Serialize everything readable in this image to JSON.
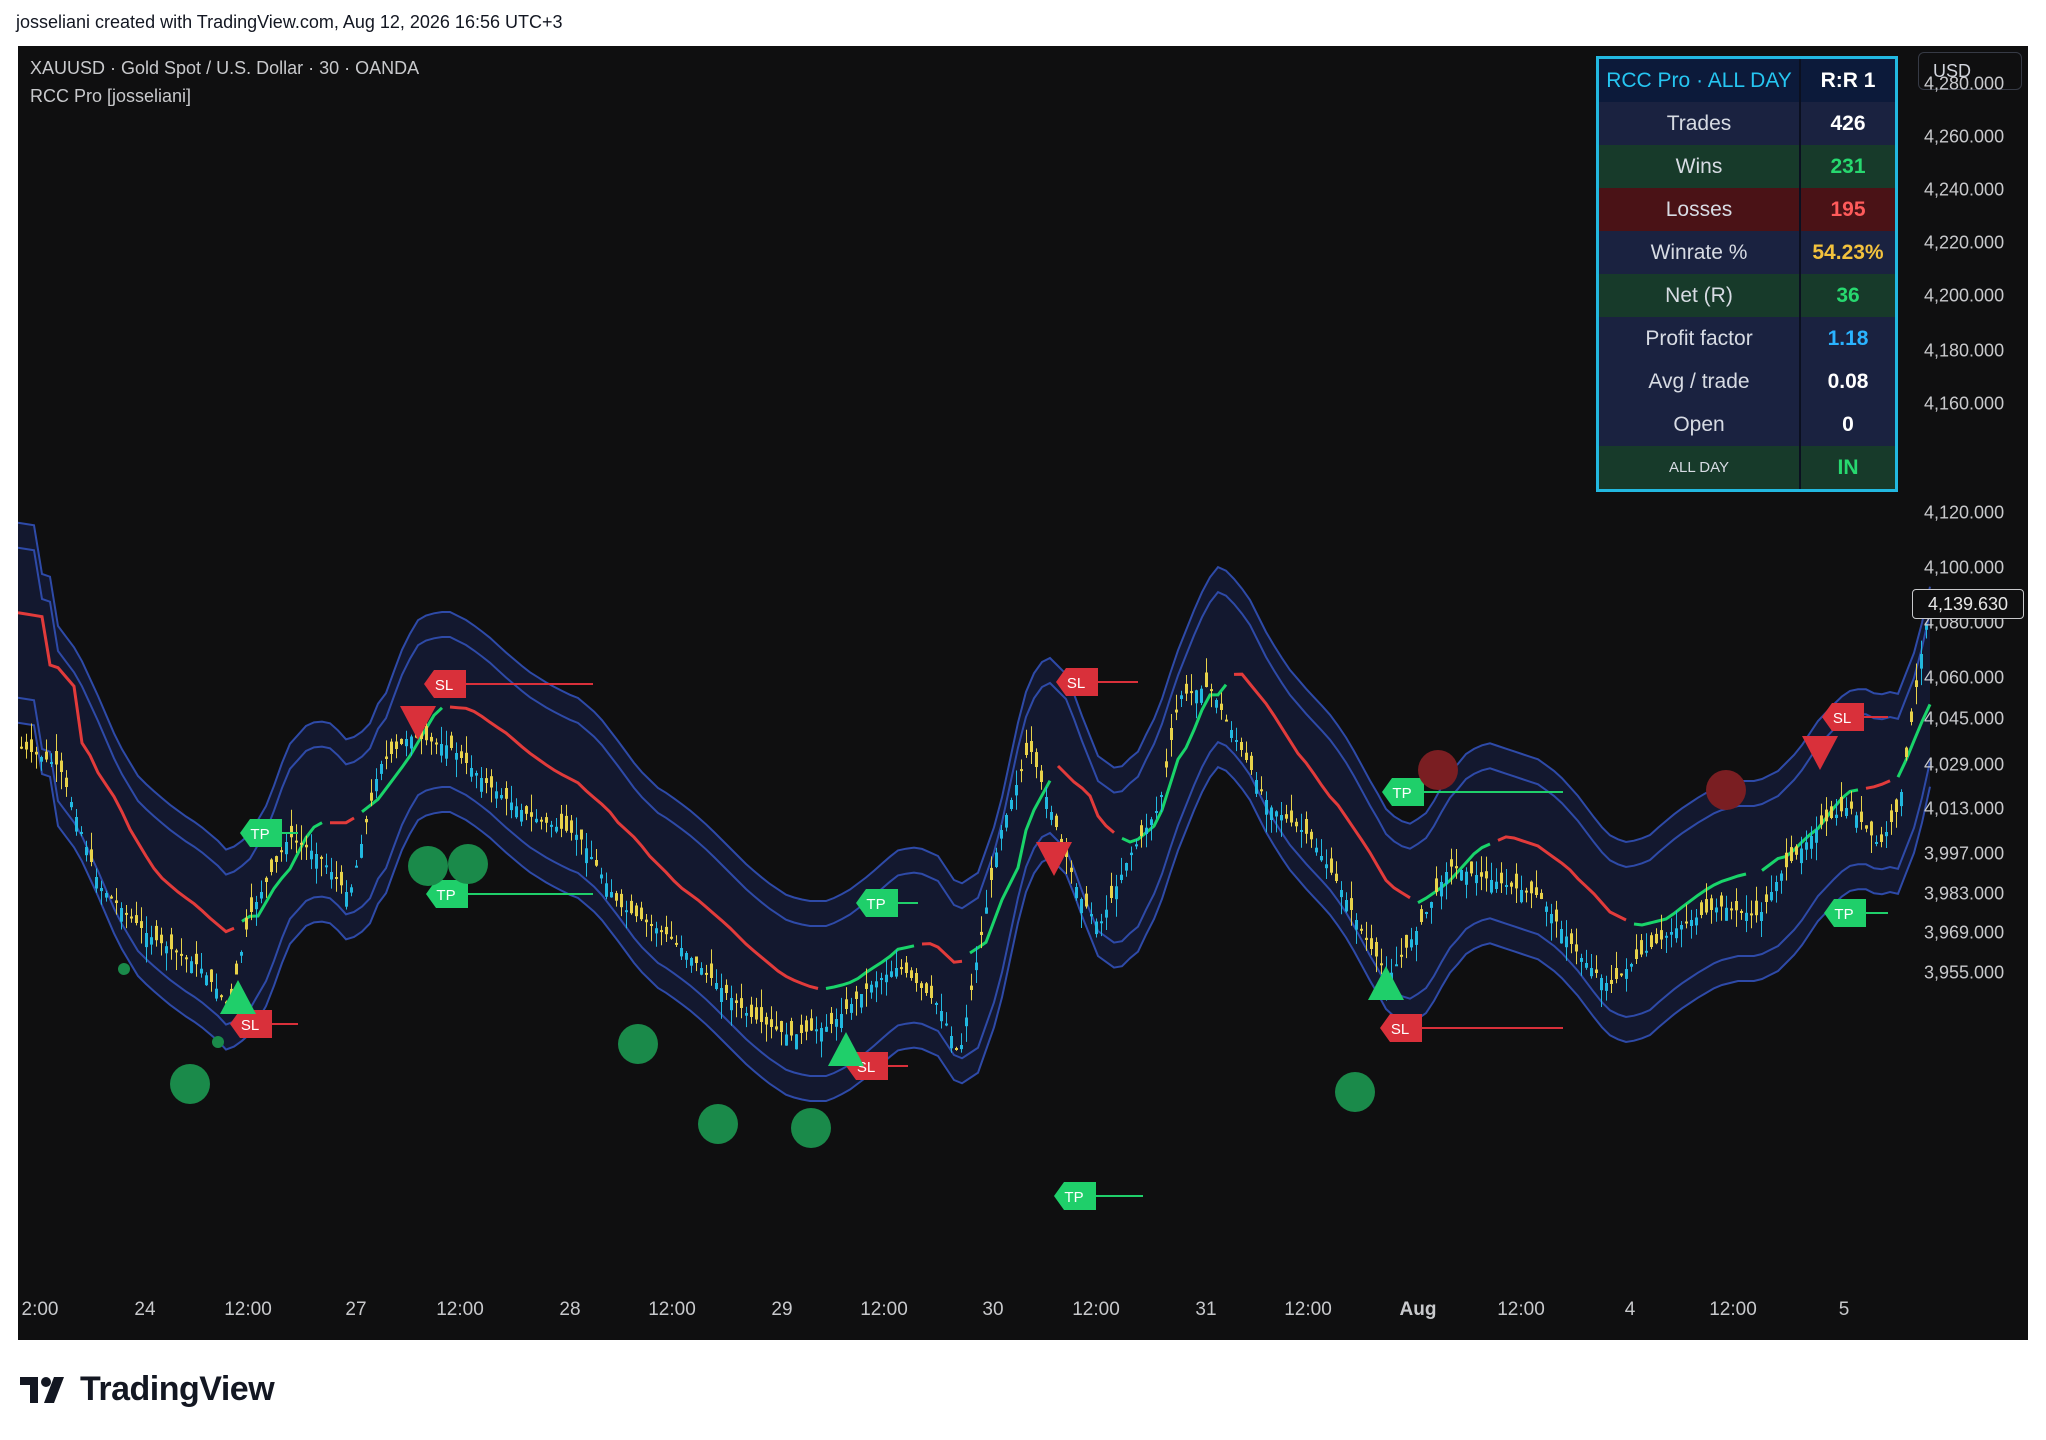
{
  "snapshot": {
    "header": "josseliani created with TradingView.com, Aug 12, 2026 16:56 UTC+3",
    "brand": "TradingView"
  },
  "chart": {
    "symbol": "XAUUSD · Gold Spot / U.S. Dollar · 30 · OANDA",
    "indicator": "RCC Pro [josseliani]",
    "currency": "USD",
    "last_price": "4,139.630",
    "colors": {
      "background": "#0f0f10",
      "up_candle": "#22b8e0",
      "down_candle": "#e8d24a",
      "band": "#2e4aa8",
      "band_fill": "#141a33",
      "baseline_up": "#19d46a",
      "baseline_down": "#e23b3b",
      "tp": "#1fcf6a",
      "sl": "#d9303a"
    }
  },
  "price_axis": {
    "ticks": [
      "4,280.000",
      "4,260.000",
      "4,240.000",
      "4,220.000",
      "4,200.000",
      "4,180.000",
      "4,160.000",
      "4,120.000",
      "4,100.000",
      "4,080.000",
      "4,060.000",
      "4,045.000",
      "4,029.000",
      "4,013.000",
      "3,997.000",
      "3,983.000",
      "3,969.000",
      "3,955.000"
    ]
  },
  "time_axis": {
    "ticks": [
      {
        "label": "2:00",
        "bold": false
      },
      {
        "label": "24",
        "bold": false
      },
      {
        "label": "12:00",
        "bold": false
      },
      {
        "label": "27",
        "bold": false
      },
      {
        "label": "12:00",
        "bold": false
      },
      {
        "label": "28",
        "bold": false
      },
      {
        "label": "12:00",
        "bold": false
      },
      {
        "label": "29",
        "bold": false
      },
      {
        "label": "12:00",
        "bold": false
      },
      {
        "label": "30",
        "bold": false
      },
      {
        "label": "12:00",
        "bold": false
      },
      {
        "label": "31",
        "bold": false
      },
      {
        "label": "12:00",
        "bold": false
      },
      {
        "label": "Aug",
        "bold": true
      },
      {
        "label": "12:00",
        "bold": false
      },
      {
        "label": "4",
        "bold": false
      },
      {
        "label": "12:00",
        "bold": false
      },
      {
        "label": "5",
        "bold": false
      }
    ]
  },
  "stats_table": {
    "header_label": "RCC Pro · ALL DAY",
    "header_value": "R:R 1",
    "rows": [
      {
        "label": "Trades",
        "value": "426",
        "row_bg": "#1a2240",
        "value_color": "#ffffff"
      },
      {
        "label": "Wins",
        "value": "231",
        "row_bg": "#173a2a",
        "value_color": "#27d86f"
      },
      {
        "label": "Losses",
        "value": "195",
        "row_bg": "#4a1216",
        "value_color": "#ff5b5b"
      },
      {
        "label": "Winrate %",
        "value": "54.23%",
        "row_bg": "#1a2240",
        "value_color": "#f3c23d"
      },
      {
        "label": "Net (R)",
        "value": "36",
        "row_bg": "#173a2a",
        "value_color": "#27d86f"
      },
      {
        "label": "Profit factor",
        "value": "1.18",
        "row_bg": "#1a2240",
        "value_color": "#2ab3ff"
      },
      {
        "label": "Avg / trade",
        "value": "0.08",
        "row_bg": "#1a2240",
        "value_color": "#ffffff"
      },
      {
        "label": "Open",
        "value": "0",
        "row_bg": "#1a2240",
        "value_color": "#ffffff"
      },
      {
        "label": "ALL DAY",
        "value": "IN",
        "row_bg": "#173a2a",
        "value_color": "#27d86f",
        "small": true
      }
    ]
  },
  "markers": {
    "tp_label": "TP",
    "sl_label": "SL"
  }
}
